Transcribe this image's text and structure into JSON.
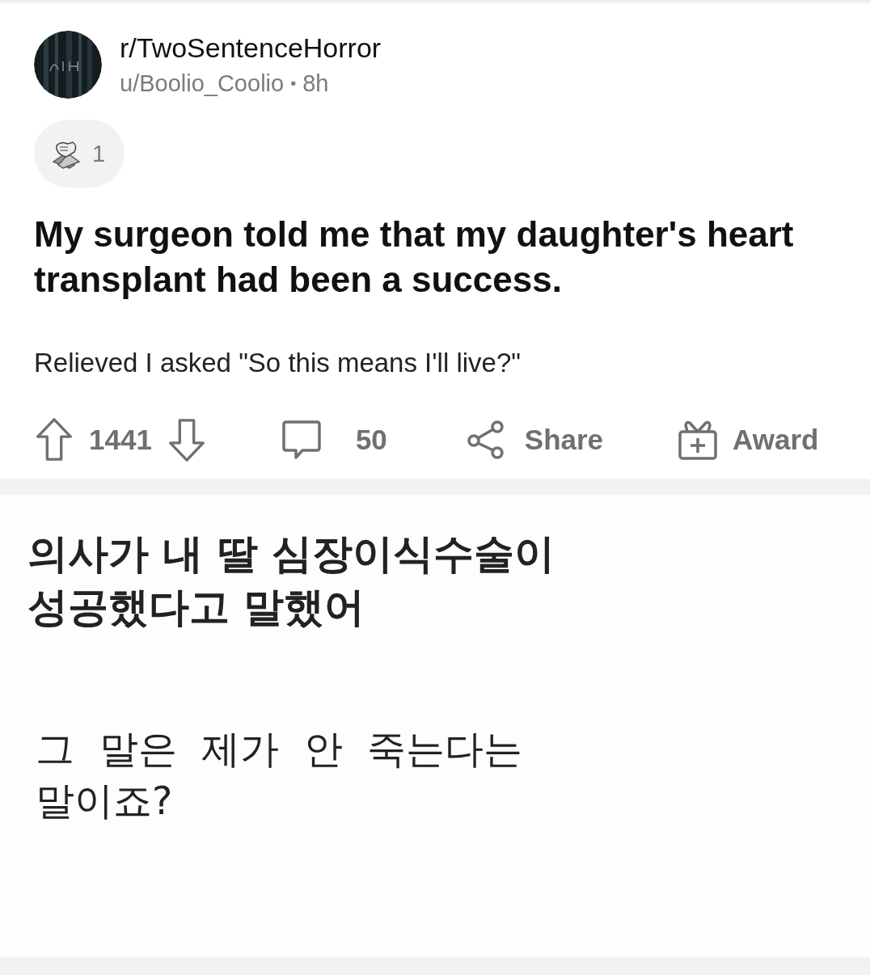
{
  "post": {
    "subreddit": "r/TwoSentenceHorror",
    "author": "u/Boolio_Coolio",
    "separator": "•",
    "age": "8h",
    "awards": [
      {
        "count": "1"
      }
    ],
    "title": "My surgeon told me that my daughter's heart transplant had been a success.",
    "body": "Relieved I asked \"So this means I'll live?\"",
    "actions": [
      {
        "kind": "upvote",
        "label": "1441"
      },
      {
        "kind": "comment",
        "label": "50"
      },
      {
        "kind": "share",
        "label": "Share"
      },
      {
        "kind": "award",
        "label": "Award"
      }
    ]
  },
  "translation": {
    "lines": [
      {
        "kind": "title",
        "text": "의사가 내 딸 심장이식수술이 성공했다고 말했어"
      },
      {
        "kind": "body",
        "text": "그  말은  제가  안  죽는다는 말이죠?"
      }
    ]
  }
}
